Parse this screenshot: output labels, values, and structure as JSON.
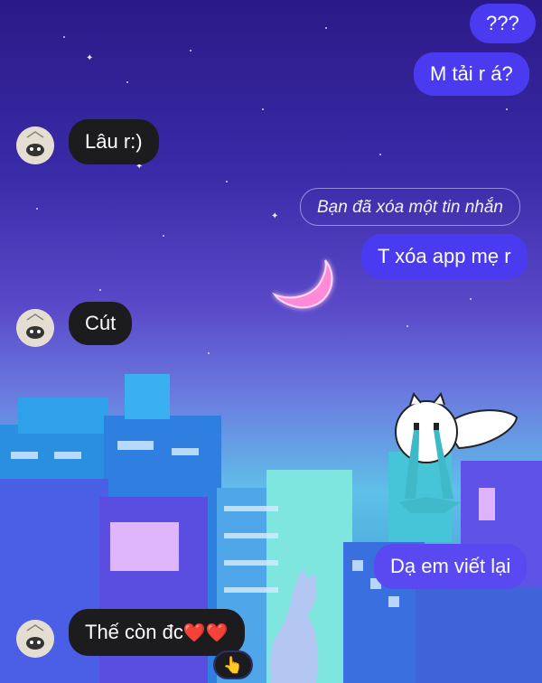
{
  "messages": [
    {
      "text": "???"
    },
    {
      "text": "M tải r á?"
    },
    {
      "text": "Lâu r:)"
    },
    {
      "text": "Bạn đã xóa một tin nhắn"
    },
    {
      "text": "T xóa app mẹ r"
    },
    {
      "text": "Cút"
    },
    {
      "text": "Dạ em viết lại"
    },
    {
      "text": "Thế còn đc"
    }
  ],
  "reactions": {
    "heart_emoji": "❤️❤️",
    "reaction_emoji": "👆"
  },
  "icons": {
    "avatar": "panda-avatar-icon",
    "moon": "crescent-moon-icon",
    "sticker": "crying-rabbit-sticker-icon"
  },
  "colors": {
    "outgoing_bubble": "#4a3bf0",
    "incoming_bubble": "#1c1c1e"
  }
}
